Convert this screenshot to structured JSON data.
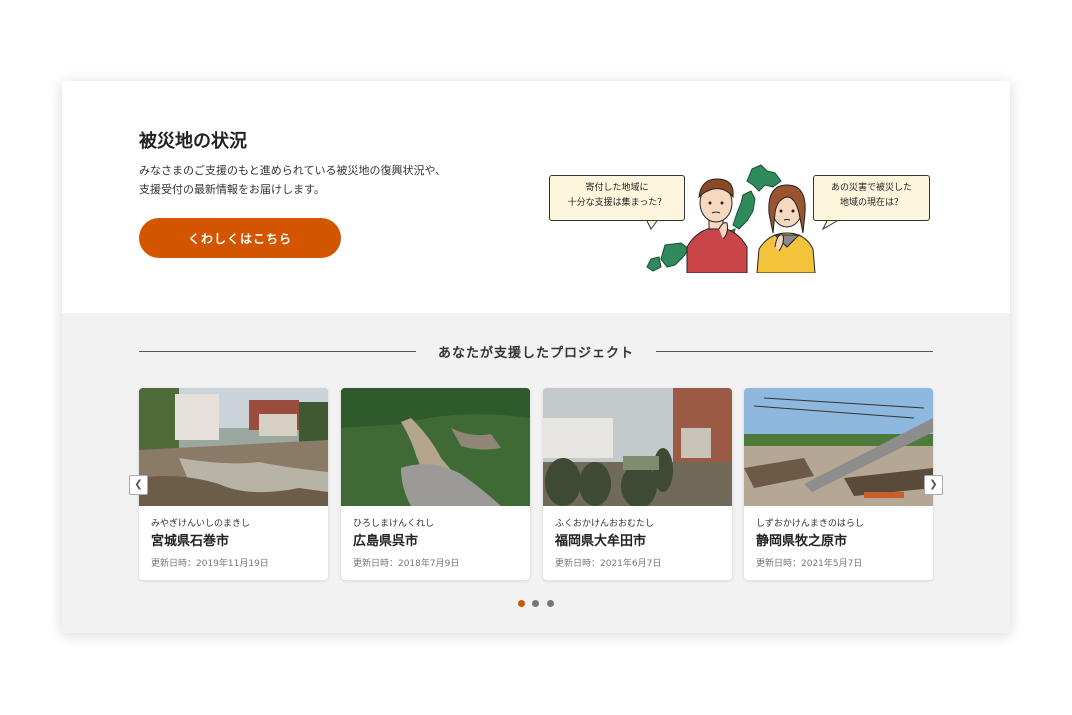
{
  "hero": {
    "title": "被災地の状況",
    "description_lines": [
      "みなさまのご支援のもと進められている被災地の復興状況や、",
      "支援受付の最新情報をお届けします。"
    ],
    "cta_label": "くわしくはこちら",
    "bubble_left": [
      "寄付した地域に",
      "十分な支援は集まった？"
    ],
    "bubble_right": [
      "あの災害で被災した",
      "地域の現在は？"
    ]
  },
  "projects": {
    "section_title": "あなたが支援したプロジェクト",
    "items": [
      {
        "kana": "みやぎけんいしのまきし",
        "city": "宮城県石巻市",
        "updated": "更新日時：2019年11月19日"
      },
      {
        "kana": "ひろしまけんくれし",
        "city": "広島県呉市",
        "updated": "更新日時：2018年7月9日"
      },
      {
        "kana": "ふくおかけんおおむたし",
        "city": "福岡県大牟田市",
        "updated": "更新日時：2021年6月7日"
      },
      {
        "kana": "しずおかけんまきのはらし",
        "city": "静岡県牧之原市",
        "updated": "更新日時：2021年5月7日"
      }
    ],
    "prev_icon": "chevron-left-icon",
    "next_icon": "chevron-right-icon",
    "pagination": {
      "total": 3,
      "active_index": 0
    }
  },
  "colors": {
    "accent": "#d45500",
    "section_bg": "#f2f2f2",
    "bubble_bg": "#fdf6dc"
  }
}
